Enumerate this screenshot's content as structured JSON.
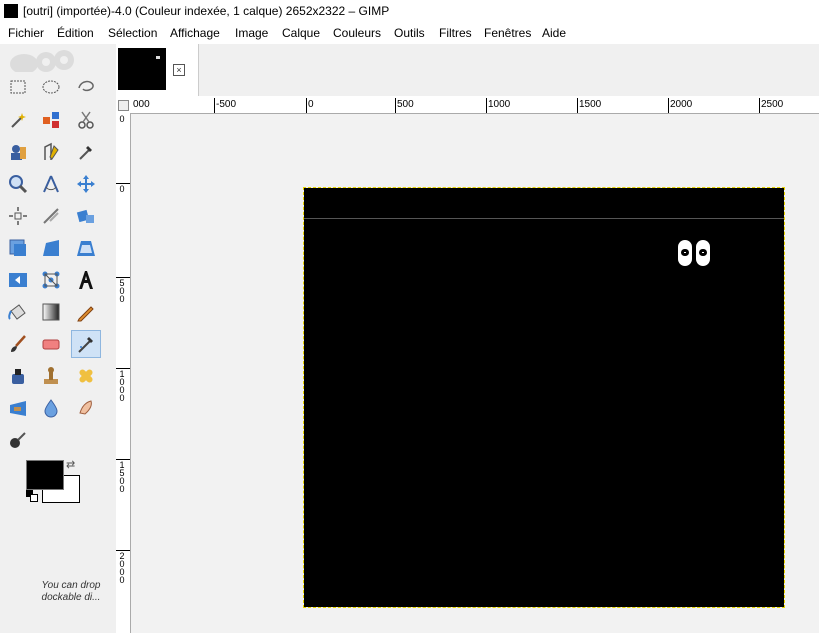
{
  "window": {
    "title": "[outri] (importée)-4.0 (Couleur indexée, 1 calque) 2652x2322 – GIMP"
  },
  "menu": [
    {
      "label": "Fichier"
    },
    {
      "label": "Édition"
    },
    {
      "label": "Sélection"
    },
    {
      "label": "Affichage"
    },
    {
      "label": "Image"
    },
    {
      "label": "Calque"
    },
    {
      "label": "Couleurs"
    },
    {
      "label": "Outils"
    },
    {
      "label": "Filtres"
    },
    {
      "label": "Fenêtres"
    },
    {
      "label": "Aide"
    }
  ],
  "toolbox": {
    "hint": "You can drop dockable di..."
  },
  "image_tab": {
    "close_glyph": "×"
  },
  "rulers": {
    "horizontal": [
      "000",
      "-500",
      "0",
      "500",
      "1000",
      "1500",
      "2000",
      "2500"
    ],
    "vertical": [
      "0",
      "0",
      "500",
      "1000",
      "1500",
      "2000"
    ]
  },
  "colors": {
    "foreground": "#000000",
    "background": "#ffffff",
    "selection_border": "#e8d500",
    "active_tool_highlight": "#cfe2f6"
  },
  "icons": [
    "rect-select-icon",
    "ellipse-select-icon",
    "free-select-icon",
    "fuzzy-select-icon",
    "select-by-color-icon",
    "scissors-icon",
    "foreground-select-icon",
    "paths-icon",
    "color-picker-icon",
    "zoom-icon",
    "measure-icon",
    "move-icon",
    "align-icon",
    "crop-icon",
    "unified-transform-icon",
    "rotate-icon",
    "scale-icon",
    "perspective-icon",
    "flip-icon",
    "cage-icon",
    "text-icon",
    "bucket-fill-icon",
    "gradient-icon",
    "pencil-icon",
    "paintbrush-icon",
    "eraser-icon",
    "airbrush-icon",
    "ink-icon",
    "clone-icon",
    "heal-icon",
    "perspective-clone-icon",
    "blur-icon",
    "smudge-icon",
    "dodge-burn-icon"
  ]
}
